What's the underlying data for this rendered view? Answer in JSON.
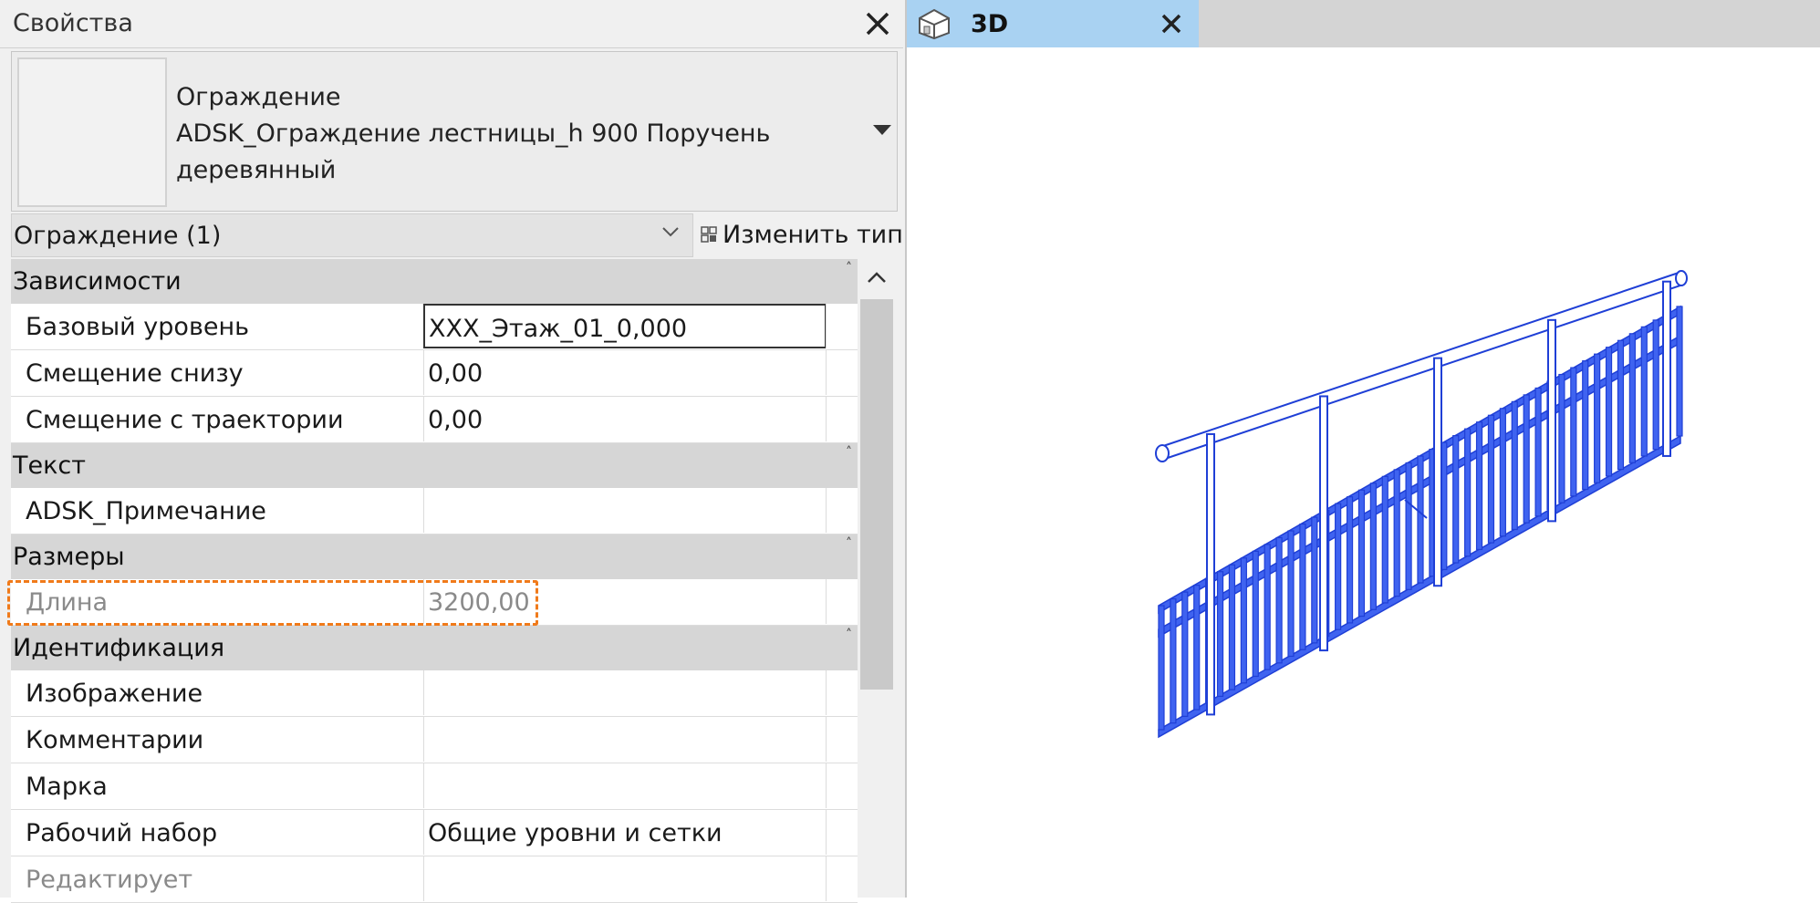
{
  "properties_panel": {
    "title": "Свойства",
    "type_selector": {
      "line1": "Ограждение",
      "line2": "ADSK_Ограждение лестницы_h 900 Поручень",
      "line3": "деревянный"
    },
    "instance_filter": "Ограждение (1)",
    "edit_type_label": "Изменить тип",
    "groups": {
      "constraints": {
        "title": "Зависимости",
        "rows": [
          {
            "label": "Базовый уровень",
            "value": "XXX_Этаж_01_0,000"
          },
          {
            "label": "Смещение снизу",
            "value": "0,00"
          },
          {
            "label": "Смещение с траектории",
            "value": "0,00"
          }
        ]
      },
      "text": {
        "title": "Текст",
        "rows": [
          {
            "label": "ADSK_Примечание",
            "value": ""
          }
        ]
      },
      "dimensions": {
        "title": "Размеры",
        "rows": [
          {
            "label": "Длина",
            "value": "3200,00"
          }
        ]
      },
      "identity": {
        "title": "Идентификация",
        "rows": [
          {
            "label": "Изображение",
            "value": ""
          },
          {
            "label": "Комментарии",
            "value": ""
          },
          {
            "label": "Марка",
            "value": ""
          },
          {
            "label": "Рабочий набор",
            "value": "Общие уровни и сетки"
          },
          {
            "label": "Редактирует",
            "value": ""
          }
        ]
      }
    }
  },
  "view": {
    "tab_label": "3D",
    "colors": {
      "tab_active": "#a9d2f2",
      "model_stroke": "#1f3fd6",
      "model_fill": "#3f63f0",
      "highlight": "#f07a1a"
    }
  }
}
